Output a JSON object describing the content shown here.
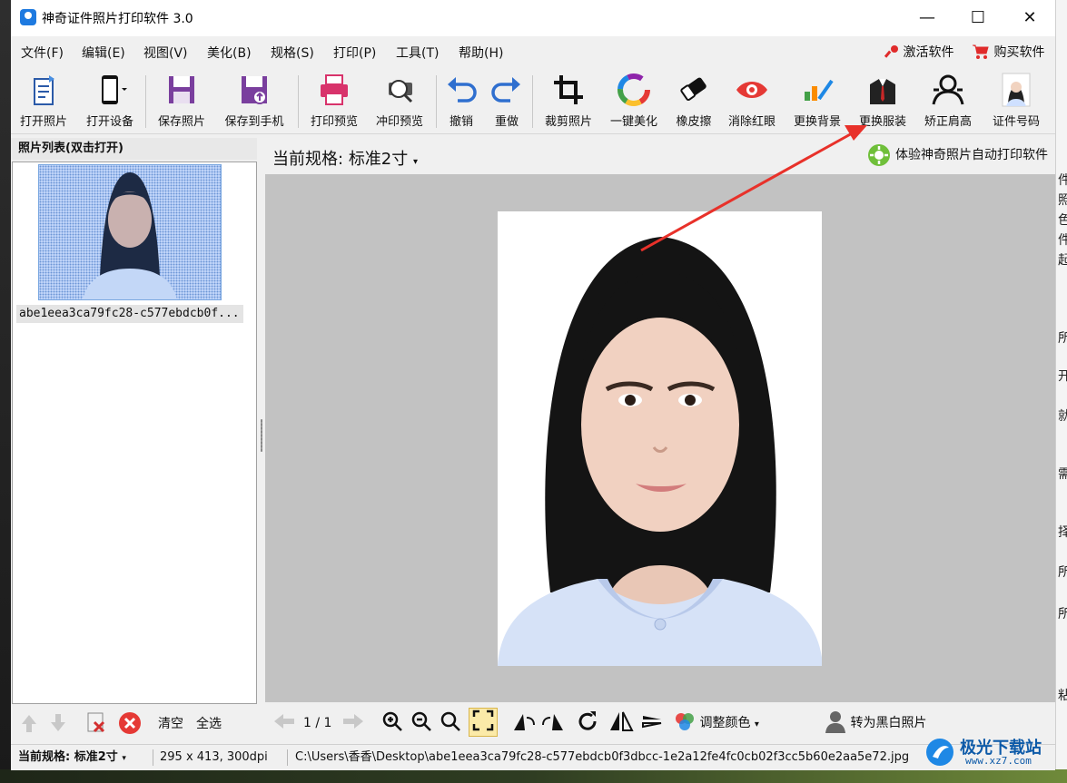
{
  "window": {
    "title": "神奇证件照片打印软件 3.0",
    "controls": {
      "minimize": "—",
      "maximize": "☐",
      "close": "✕"
    }
  },
  "menu": {
    "items": [
      "文件(F)",
      "编辑(E)",
      "视图(V)",
      "美化(B)",
      "规格(S)",
      "打印(P)",
      "工具(T)",
      "帮助(H)"
    ],
    "activate": "激活软件",
    "buy": "购买软件"
  },
  "toolbar": {
    "open_photo": "打开照片",
    "open_device": "打开设备",
    "save_photo": "保存照片",
    "save_to_phone": "保存到手机",
    "print_preview": "打印预览",
    "develop_preview": "冲印预览",
    "undo": "撤销",
    "redo": "重做",
    "crop": "裁剪照片",
    "beautify": "一键美化",
    "eraser": "橡皮擦",
    "red_eye": "消除红眼",
    "change_bg": "更换背景",
    "change_clothes": "更换服装",
    "fix_shoulder": "矫正肩高",
    "id_number": "证件号码"
  },
  "photo_list": {
    "header": "照片列表(双击打开)",
    "items": [
      {
        "caption": "abe1eea3ca79fc28-c577ebdcb0f..."
      }
    ],
    "clear": "清空",
    "select_all": "全选"
  },
  "main": {
    "spec_prefix": "当前规格:",
    "spec_value": "标准2寸",
    "try_auto_print": "体验神奇照片自动打印软件"
  },
  "bottom_toolbar": {
    "page": "1 / 1",
    "adjust_color": "调整颜色",
    "to_bw": "转为黑白照片"
  },
  "status": {
    "spec_prefix": "当前规格:",
    "spec_value": "标准2寸",
    "size": "295 x 413, 300dpi",
    "path": "C:\\Users\\香香\\Desktop\\abe1eea3ca79fc28-c577ebdcb0f3dbcc-1e2a12fe4fc0cb02f3cc5b60e2aa5e72.jpg"
  },
  "watermark": {
    "text": "极光下载站",
    "url": "www.xz7.com"
  },
  "desktop_right_chars": [
    "件",
    "照",
    "色",
    "件",
    "起",
    "所",
    "开",
    "就",
    "需",
    "择",
    "所",
    "所",
    "粘"
  ],
  "colors": {
    "accent_blue": "#1e7ae0",
    "annotation_red": "#e8312a",
    "canvas_gray": "#c2c2c2"
  }
}
